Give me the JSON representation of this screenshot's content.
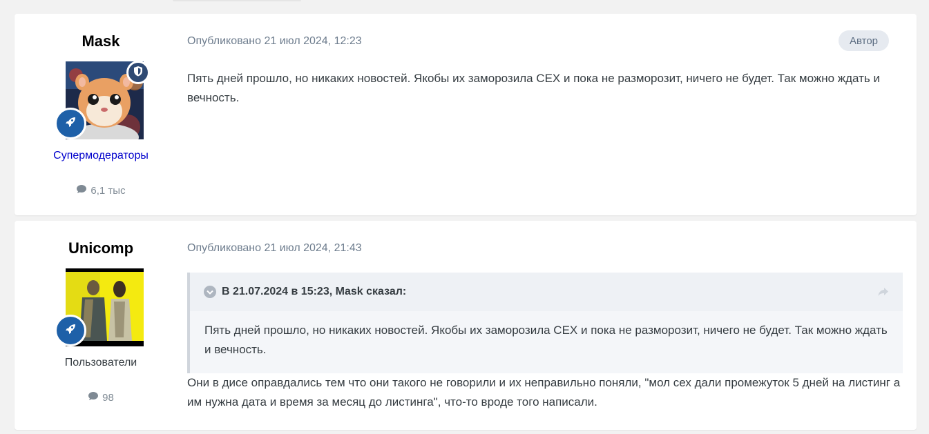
{
  "posts": [
    {
      "author": "Mask",
      "group": "Супермодераторы",
      "post_count": "6,1 тыс",
      "published": "Опубликовано 21 июл 2024, 12:23",
      "author_badge": "Автор",
      "content": "Пять дней прошло, но никаких новостей. Якобы их заморозила CEX и пока не разморозит, ничего не будет. Так можно ждать и вечность.",
      "icons": {
        "rank": "rocket-icon",
        "moderator": "shield-icon",
        "posts": "comment-icon"
      }
    },
    {
      "author": "Unicomp",
      "group": "Пользователи",
      "post_count": "98",
      "published": "Опубликовано 21 июл 2024, 21:43",
      "quote": {
        "citation": "В 21.07.2024 в 15:23, Mask сказал:",
        "text": "Пять дней прошло, но никаких новостей. Якобы их заморозила CEX и пока не разморозит, ничего не будет. Так можно ждать и вечность."
      },
      "content": "Они в дисе оправдались тем что они такого не говорили и их неправильно поняли, \"мол сех дали промежуток 5 дней на листинг а им нужна дата и время за месяц до листинга\", что-то вроде того написали.",
      "icons": {
        "rank": "rocket-icon",
        "posts": "comment-icon",
        "quote_toggle": "chevron-down-icon",
        "share": "share-icon"
      }
    }
  ],
  "colors": {
    "moderator_group": "#0000cc",
    "rank_badge": "#1e60a8",
    "meta_text": "#6d7c8d"
  }
}
